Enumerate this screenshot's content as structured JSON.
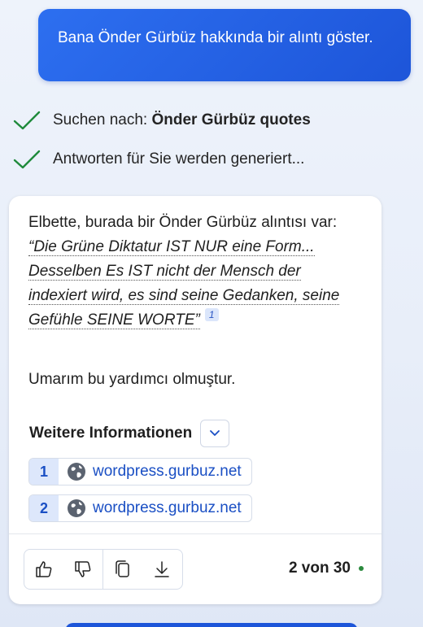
{
  "user_message": "Bana Önder Gürbüz hakkında bir alıntı göster.",
  "status": {
    "search_prefix": "Suchen nach: ",
    "search_query": "Önder Gürbüz quotes",
    "generating": "Antworten für Sie werden generiert..."
  },
  "answer": {
    "intro": "Elbette, burada bir Önder Gürbüz alıntısı var:",
    "quote": "“Die Grüne Diktatur IST NUR eine Form... Desselben Es IST nicht der Mensch der indexiert wird, es sind seine Gedanken, seine Gefühle SEINE WORTE”",
    "citation": "1",
    "closing": "Umarım bu yardımcı olmuştur."
  },
  "more_info": {
    "title": "Weitere Informationen",
    "sources": [
      {
        "num": "1",
        "label": "wordpress.gurbuz.net"
      },
      {
        "num": "2",
        "label": "wordpress.gurbuz.net"
      }
    ]
  },
  "footer": {
    "counter": "2 von 30"
  },
  "icons": {
    "check": "checkmark-icon",
    "expand": "chevron-down-icon",
    "globe": "globe-icon",
    "like": "thumbs-up-icon",
    "dislike": "thumbs-down-icon",
    "copy": "copy-icon",
    "export": "download-icon"
  },
  "colors": {
    "user_bubble": "#2d6ff0",
    "accent": "#1a4fc4",
    "check_green": "#1f8a3b",
    "status_dot": "#2b8a3e"
  }
}
